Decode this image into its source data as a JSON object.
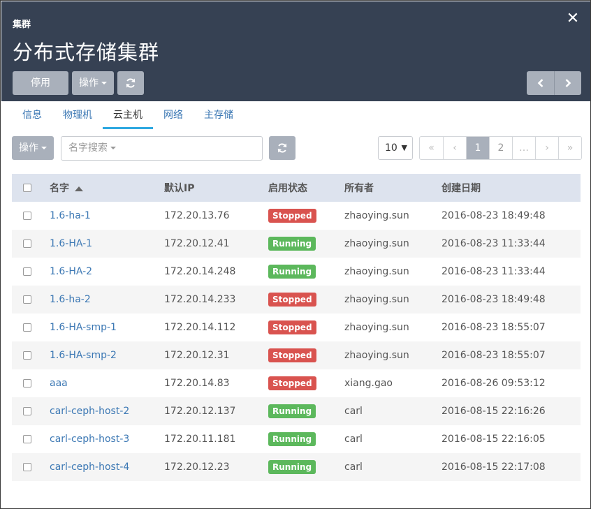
{
  "header": {
    "breadcrumb": "集群",
    "title": "分布式存储集群",
    "stop_label": "停用",
    "ops_label": "操作"
  },
  "icons": {
    "close": "close-icon",
    "refresh": "refresh-icon",
    "prev": "chevron-left-icon",
    "next": "chevron-right-icon"
  },
  "tabs": [
    {
      "label": "信息"
    },
    {
      "label": "物理机"
    },
    {
      "label": "云主机",
      "active": true
    },
    {
      "label": "网络"
    },
    {
      "label": "主存储"
    }
  ],
  "toolbar": {
    "ops_label": "操作",
    "search_placeholder": "名字搜索",
    "page_size": "10"
  },
  "pagination": {
    "first": "«",
    "prev": "‹",
    "pages": [
      "1",
      "2",
      "…"
    ],
    "current": "1",
    "next": "›",
    "last": "»"
  },
  "table": {
    "columns": [
      "名字",
      "默认IP",
      "启用状态",
      "所有者",
      "创建日期"
    ],
    "rows": [
      {
        "name": "1.6-ha-1",
        "ip": "172.20.13.76",
        "state": "Stopped",
        "owner": "zhaoying.sun",
        "created": "2016-08-23 18:49:48"
      },
      {
        "name": "1.6-HA-1",
        "ip": "172.20.12.41",
        "state": "Running",
        "owner": "zhaoying.sun",
        "created": "2016-08-23 11:33:44"
      },
      {
        "name": "1.6-HA-2",
        "ip": "172.20.14.248",
        "state": "Running",
        "owner": "zhaoying.sun",
        "created": "2016-08-23 11:33:44"
      },
      {
        "name": "1.6-ha-2",
        "ip": "172.20.14.233",
        "state": "Stopped",
        "owner": "zhaoying.sun",
        "created": "2016-08-23 18:49:48"
      },
      {
        "name": "1.6-HA-smp-1",
        "ip": "172.20.14.112",
        "state": "Stopped",
        "owner": "zhaoying.sun",
        "created": "2016-08-23 18:55:07"
      },
      {
        "name": "1.6-HA-smp-2",
        "ip": "172.20.12.31",
        "state": "Stopped",
        "owner": "zhaoying.sun",
        "created": "2016-08-23 18:55:07"
      },
      {
        "name": "aaa",
        "ip": "172.20.14.83",
        "state": "Stopped",
        "owner": "xiang.gao",
        "created": "2016-08-26 09:53:12"
      },
      {
        "name": "carl-ceph-host-2",
        "ip": "172.20.12.137",
        "state": "Running",
        "owner": "carl",
        "created": "2016-08-15 22:16:26"
      },
      {
        "name": "carl-ceph-host-3",
        "ip": "172.20.11.181",
        "state": "Running",
        "owner": "carl",
        "created": "2016-08-15 22:16:05"
      },
      {
        "name": "carl-ceph-host-4",
        "ip": "172.20.12.23",
        "state": "Running",
        "owner": "carl",
        "created": "2016-08-15 22:17:08"
      }
    ]
  },
  "colors": {
    "header_bg": "#364153",
    "button_gray": "#a9b0bb",
    "link": "#3c78b4",
    "tab_underline": "#2da8e0",
    "stopped": "#d9534f",
    "running": "#5cb85c",
    "table_head": "#dde3ee"
  }
}
